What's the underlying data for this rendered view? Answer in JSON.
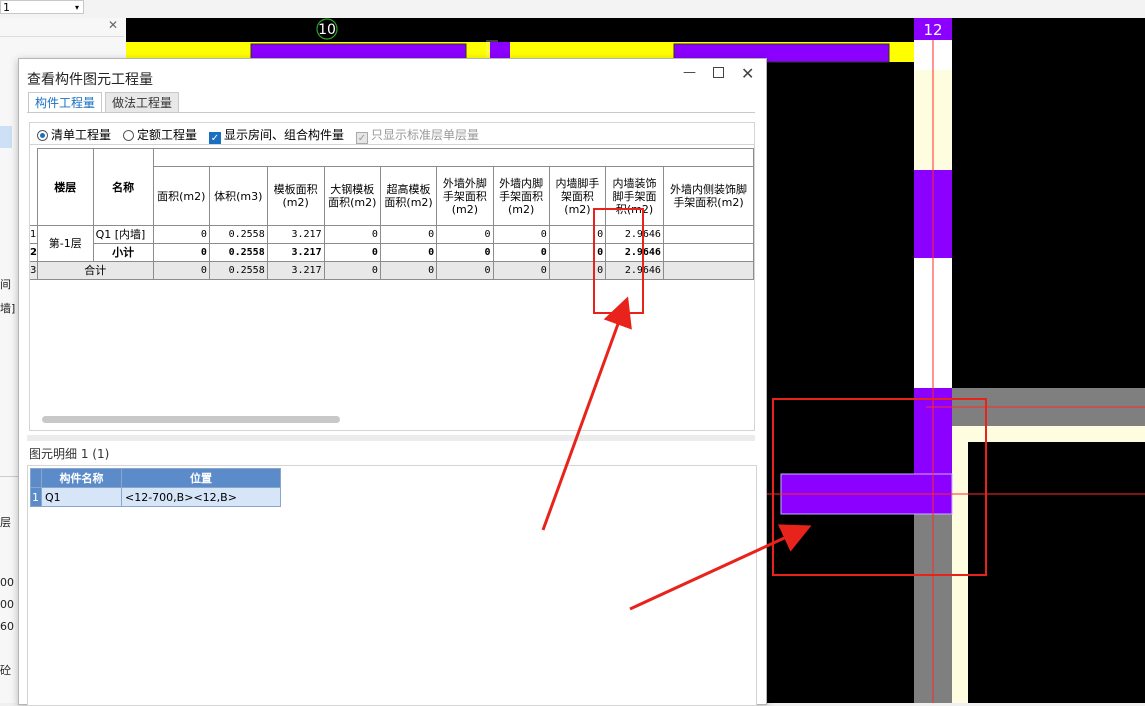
{
  "app": {
    "top_combo_value": "1",
    "left_panel_fragments": [
      "间",
      "墙]",
      "层",
      "00",
      "00",
      "60",
      "砼"
    ]
  },
  "cad": {
    "axis_10": "10",
    "axis_12": "12",
    "colors": {
      "background": "#000000",
      "wall_yellow": "#ffff00",
      "purple": "#8b00ff",
      "gray": "#7f7f7f",
      "cream": "#fffde0",
      "red_line": "#ff0000"
    }
  },
  "dialog": {
    "title": "查看构件图元工程量",
    "tabs": [
      "构件工程量",
      "做法工程量"
    ],
    "options": {
      "radio_list": "清单工程量",
      "radio_quota": "定额工程量",
      "check_rooms": "显示房间、组合构件量",
      "check_std": "只显示标准层单层量"
    },
    "table": {
      "col_floor": "楼层",
      "col_name": "名称",
      "columns": [
        "面积(m2)",
        "体积(m3)",
        "模板面积(m2)",
        "大钢模板面积(m2)",
        "超高模板面积(m2)",
        "外墙外脚手架面积(m2)",
        "外墙内脚手架面积(m2)",
        "内墙脚手架面积(m2)",
        "内墙装饰脚手架面积(m2)",
        "外墙内侧装饰脚手架面积(m2)"
      ],
      "rows": [
        {
          "idx": "1",
          "floor": "第-1层",
          "name": "Q1 [内墙]",
          "values": [
            "0",
            "0.2558",
            "3.217",
            "0",
            "0",
            "0",
            "0",
            "0",
            "2.9646",
            ""
          ]
        },
        {
          "idx": "2",
          "name": "小计",
          "values": [
            "0",
            "0.2558",
            "3.217",
            "0",
            "0",
            "0",
            "0",
            "0",
            "2.9646",
            ""
          ]
        },
        {
          "idx": "3",
          "name": "合计",
          "values": [
            "0",
            "0.2558",
            "3.217",
            "0",
            "0",
            "0",
            "0",
            "0",
            "2.9646",
            ""
          ]
        }
      ]
    },
    "detail": {
      "label": "图元明细  1 (1)",
      "headers": [
        "构件名称",
        "位置"
      ],
      "rows": [
        {
          "idx": "1",
          "name": "Q1",
          "position": "<12-700,B><12,B>"
        }
      ]
    }
  }
}
